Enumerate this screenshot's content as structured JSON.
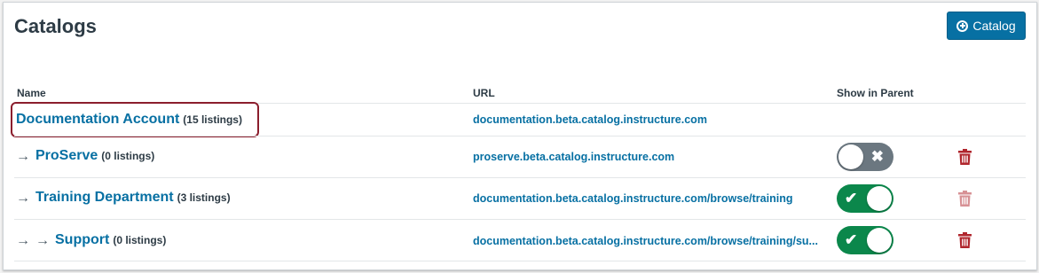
{
  "header": {
    "title": "Catalogs",
    "add_button_label": "Catalog",
    "add_button_icon": "plus-circle-icon"
  },
  "table": {
    "columns": [
      "Name",
      "URL",
      "Show in Parent"
    ],
    "rows": [
      {
        "name": "Documentation Account",
        "listings": "(15 listings)",
        "url": "documentation.beta.catalog.instructure.com",
        "depth": 0,
        "highlighted": true
      },
      {
        "name": "ProServe",
        "listings": "(0 listings)",
        "url": "proserve.beta.catalog.instructure.com",
        "depth": 1,
        "show_in_parent": false,
        "delete_enabled": true
      },
      {
        "name": "Training Department",
        "listings": "(3 listings)",
        "url": "documentation.beta.catalog.instructure.com/browse/training",
        "depth": 1,
        "show_in_parent": true,
        "delete_enabled": false
      },
      {
        "name": "Support",
        "listings": "(0 listings)",
        "url": "documentation.beta.catalog.instructure.com/browse/training/su...",
        "depth": 2,
        "show_in_parent": true,
        "delete_enabled": true
      }
    ]
  },
  "icons": {
    "child_arrow": "→",
    "toggle_off": "✖",
    "toggle_on": "✔"
  },
  "colors": {
    "link": "#0770a3",
    "primary_button": "#0770a3",
    "toggle_on": "#0b874b",
    "toggle_off": "#6b7780",
    "delete": "#b0262d",
    "highlight_border": "#8b1e2d"
  }
}
